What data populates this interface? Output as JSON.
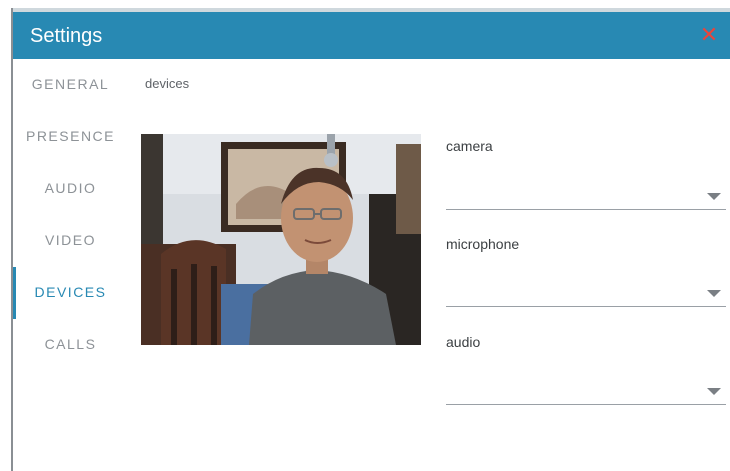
{
  "dialog": {
    "title": "Settings",
    "close_glyph": "✕",
    "accent_color": "#2889b3",
    "close_color": "#e8453c"
  },
  "nav": {
    "items": [
      {
        "label": "GENERAL"
      },
      {
        "label": "PRESENCE"
      },
      {
        "label": "AUDIO"
      },
      {
        "label": "VIDEO"
      },
      {
        "label": "DEVICES",
        "active": true
      },
      {
        "label": "CALLS"
      }
    ]
  },
  "main": {
    "section_label": "devices",
    "preview_icon": "webcam-preview-image",
    "fields": {
      "camera": {
        "label": "camera",
        "value": ""
      },
      "microphone": {
        "label": "microphone",
        "value": ""
      },
      "audio": {
        "label": "audio",
        "value": ""
      }
    }
  }
}
